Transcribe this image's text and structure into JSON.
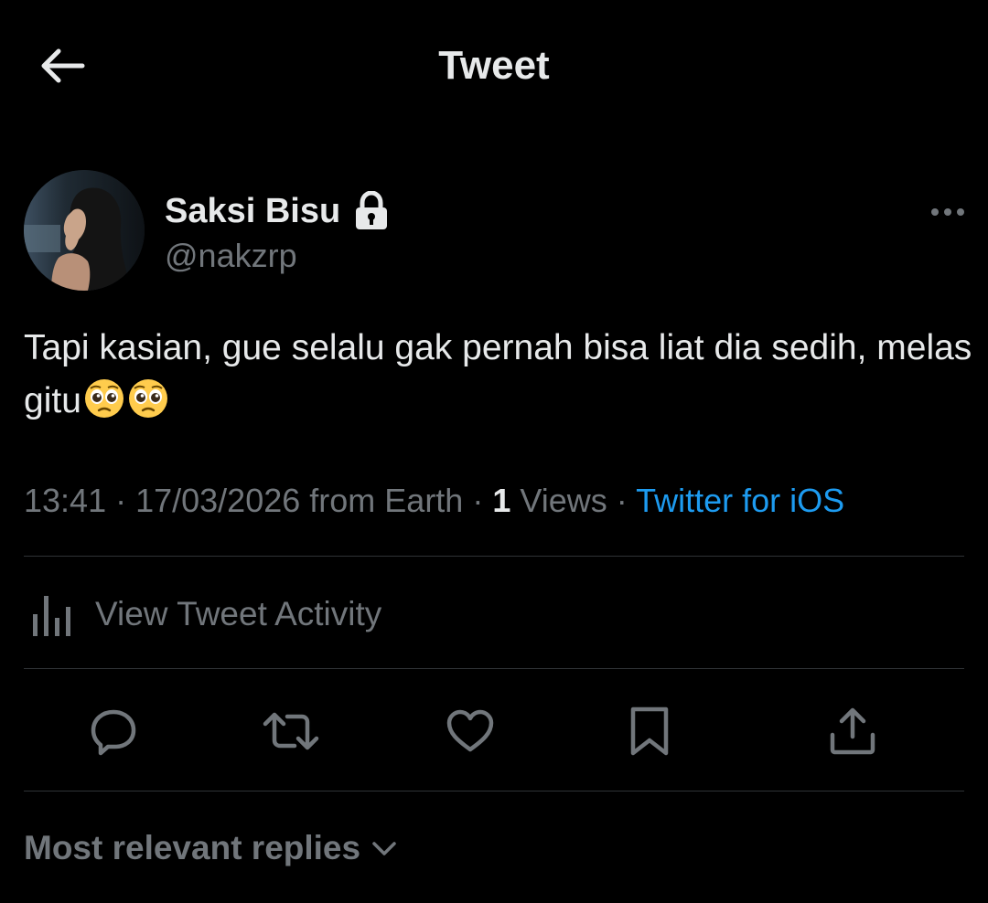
{
  "header": {
    "title": "Tweet",
    "back_icon": "back-arrow-icon"
  },
  "author": {
    "display_name": "Saksi Bisu",
    "handle": "@nakzrp",
    "protected_icon": "lock-icon"
  },
  "tweet": {
    "text": "Tapi kasian, gue selalu gak pernah bisa liat dia sedih, melas gitu",
    "emojis": [
      "pleading-face-emoji",
      "pleading-face-emoji"
    ]
  },
  "meta": {
    "time": "13:41",
    "sep1": " · ",
    "date": "17/03/2026",
    "location": " from Earth",
    "sep2": " · ",
    "views_count": "1",
    "views_label": " Views",
    "sep3": " · ",
    "source": "Twitter for iOS"
  },
  "activity": {
    "label": "View Tweet Activity",
    "icon": "analytics-bars-icon"
  },
  "actions": [
    {
      "name": "reply",
      "icon": "reply-icon"
    },
    {
      "name": "retweet",
      "icon": "retweet-icon"
    },
    {
      "name": "like",
      "icon": "heart-icon"
    },
    {
      "name": "bookmark",
      "icon": "bookmark-icon"
    },
    {
      "name": "share",
      "icon": "share-icon"
    }
  ],
  "replies": {
    "sort_label": "Most relevant replies"
  },
  "colors": {
    "background": "#000000",
    "text_primary": "#e7e9ea",
    "text_secondary": "#71767b",
    "accent": "#1d9bf0",
    "divider": "#2f3336"
  }
}
